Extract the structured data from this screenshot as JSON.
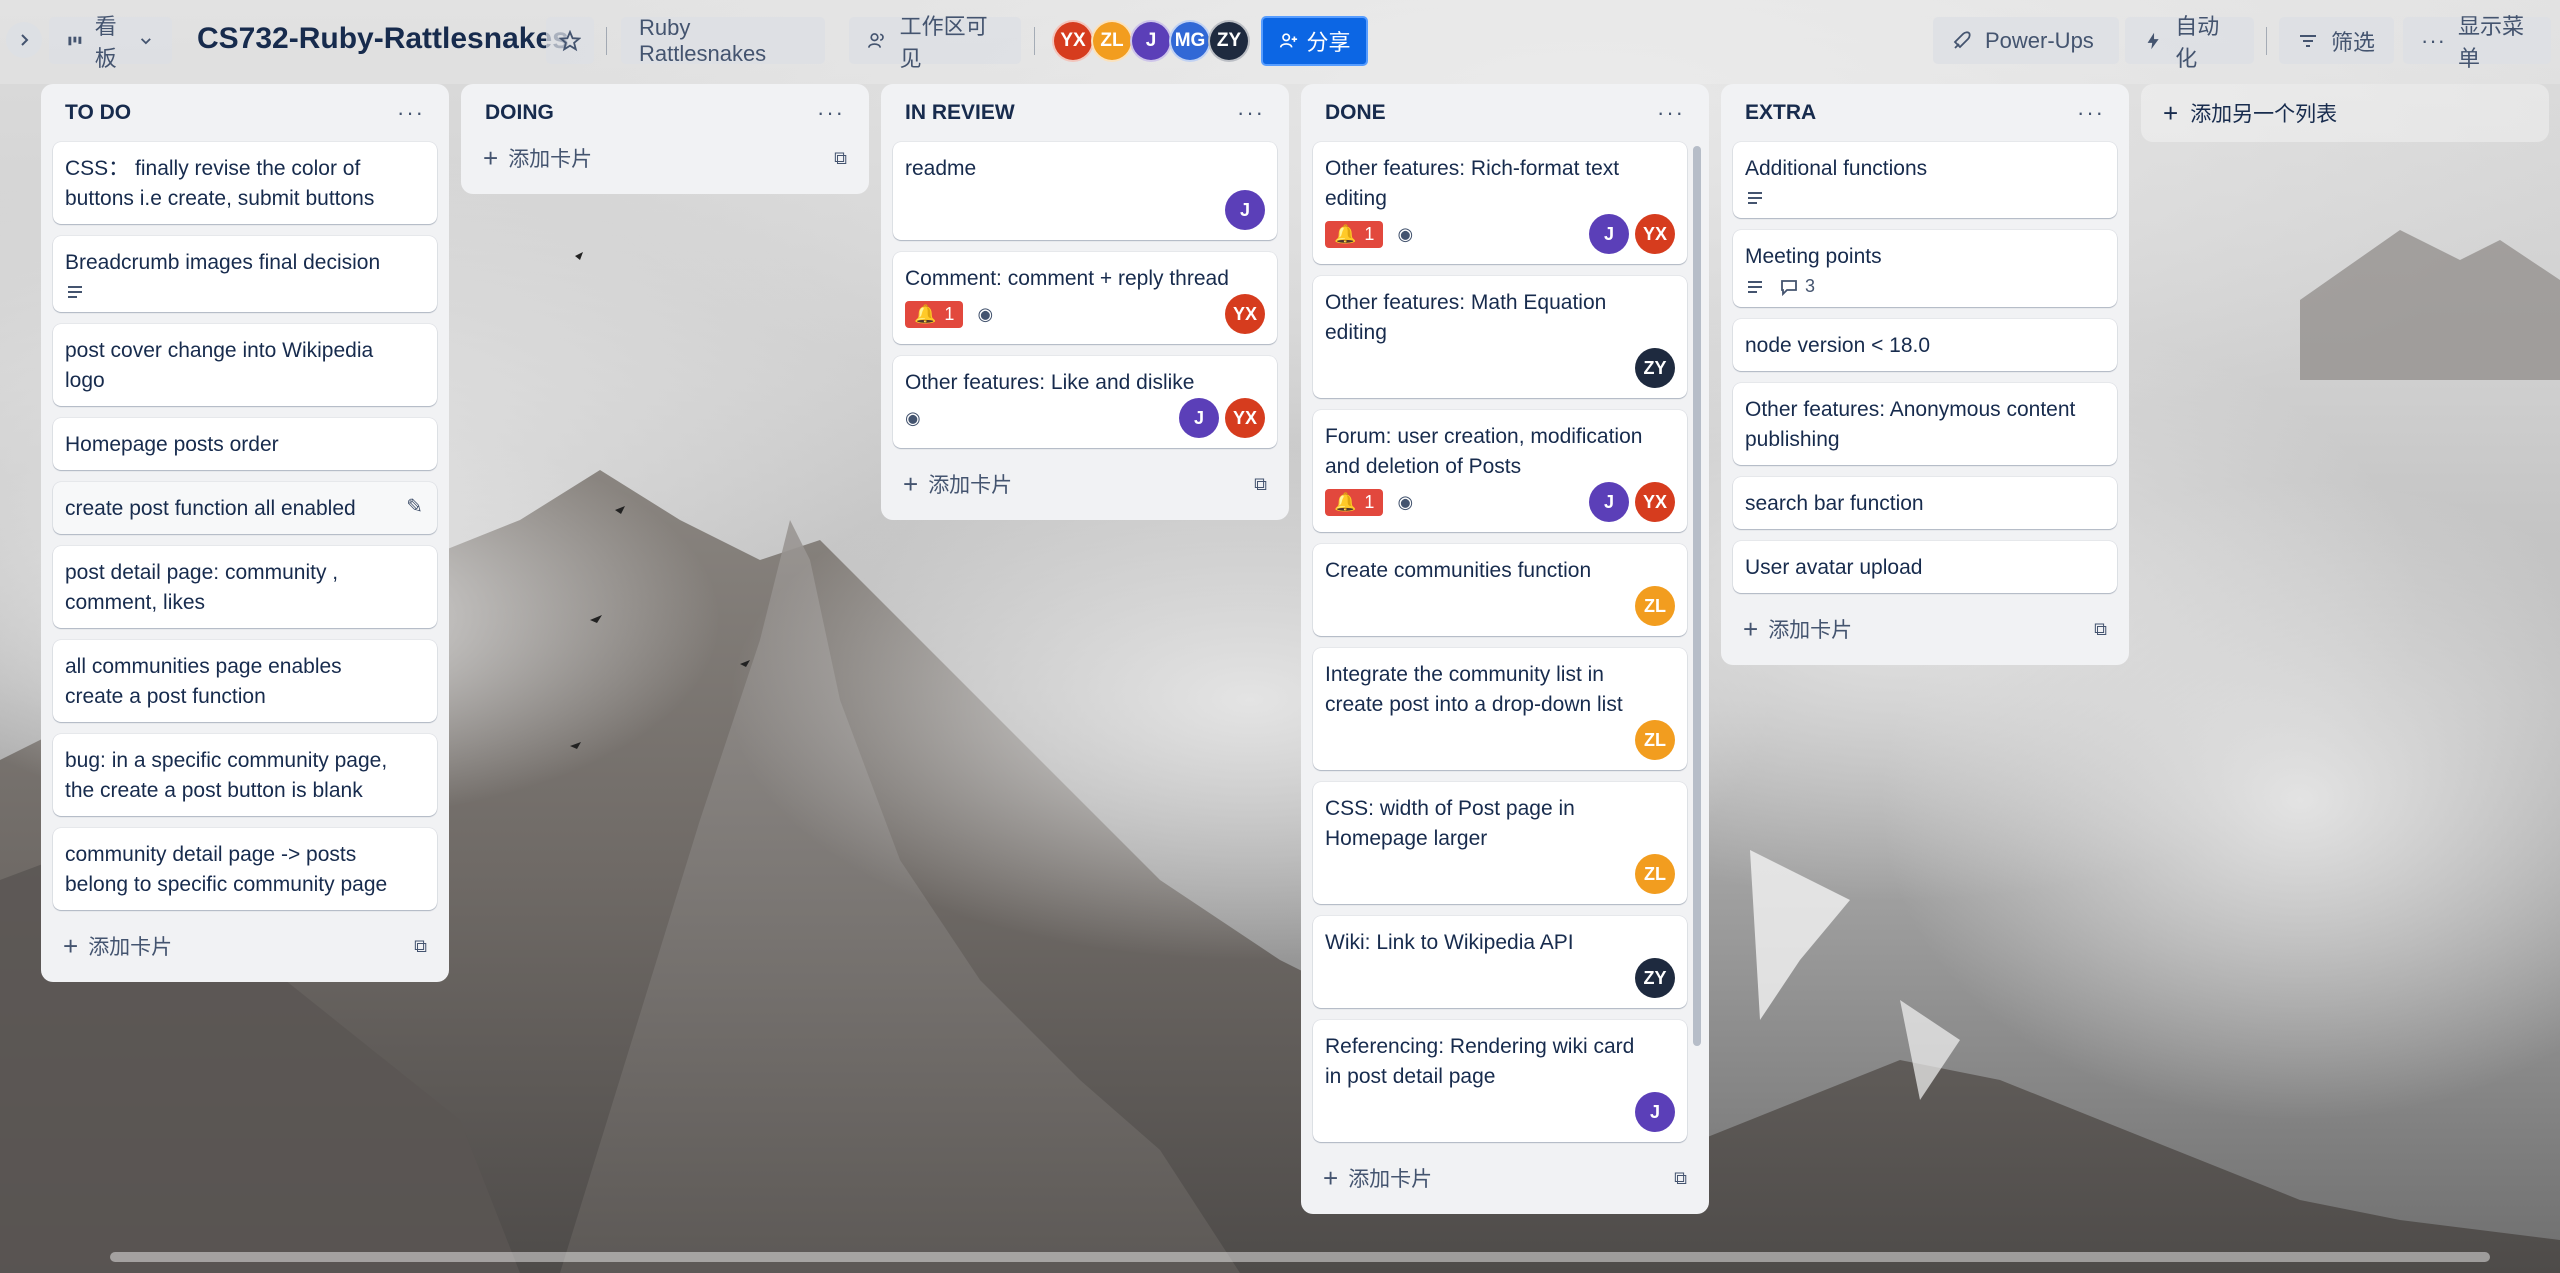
{
  "header": {
    "view_label": "看板",
    "board_title": "CS732-Ruby-Rattlesnakes",
    "workspace_name": "Ruby Rattlesnakes",
    "visibility_label": "工作区可见",
    "share_label": "分享",
    "powerups_label": "Power-Ups",
    "automation_label": "自动化",
    "filter_label": "筛选",
    "menu_label": "显示菜单",
    "members": [
      {
        "initials": "YX",
        "color": "#d63c1e"
      },
      {
        "initials": "ZL",
        "color": "#f29d1f"
      },
      {
        "initials": "J",
        "color": "#5b3fb8"
      },
      {
        "initials": "MG",
        "color": "#3168d6"
      },
      {
        "initials": "ZY",
        "color": "#1e2a3f"
      }
    ]
  },
  "colors": {
    "yx": "#d63c1e",
    "zl": "#f29d1f",
    "j": "#5b3fb8",
    "zy": "#1e2a3f",
    "badge_red": "#e2483d",
    "share_blue": "#0c66e4"
  },
  "lists": {
    "todo": {
      "title": "TO DO",
      "cards": [
        "CSS： finally revise the color of buttons i.e create, submit buttons",
        "Breadcrumb images final decision",
        "post cover change into Wikipedia logo",
        "Homepage posts order",
        "create post function all enabled",
        "post detail page: community , comment, likes",
        "all communities page enables create a post function",
        "bug: in a specific community page, the create a post button is blank",
        "community detail page -> posts belong to specific community page"
      ],
      "add_label": "添加卡片"
    },
    "doing": {
      "title": "DOING",
      "add_label": "添加卡片"
    },
    "review": {
      "title": "IN REVIEW",
      "cards": [
        "readme",
        "Comment: comment + reply thread",
        "Other features: Like and dislike"
      ],
      "badge_count": "1",
      "add_label": "添加卡片"
    },
    "done": {
      "title": "DONE",
      "cards": [
        "Other features: Rich-format text editing",
        "Other features: Math Equation editing",
        "Forum: user creation, modification and deletion of Posts",
        "Create communities function",
        "Integrate the community list in create post into a drop-down list",
        "CSS: width of Post page in Homepage larger",
        "Wiki: Link to Wikipedia API",
        "Referencing: Rendering wiki card in post detail page"
      ],
      "badge_count": "1",
      "add_label": "添加卡片"
    },
    "extra": {
      "title": "EXTRA",
      "cards": [
        "Additional functions",
        "Meeting points",
        "node version < 18.0",
        "Other features: Anonymous content publishing",
        "search bar function",
        "User avatar upload"
      ],
      "comment_count": "3",
      "add_label": "添加卡片"
    }
  },
  "add_list_label": "添加另一个列表",
  "member_initials": {
    "j": "J",
    "yx": "YX",
    "zl": "ZL",
    "zy": "ZY"
  }
}
